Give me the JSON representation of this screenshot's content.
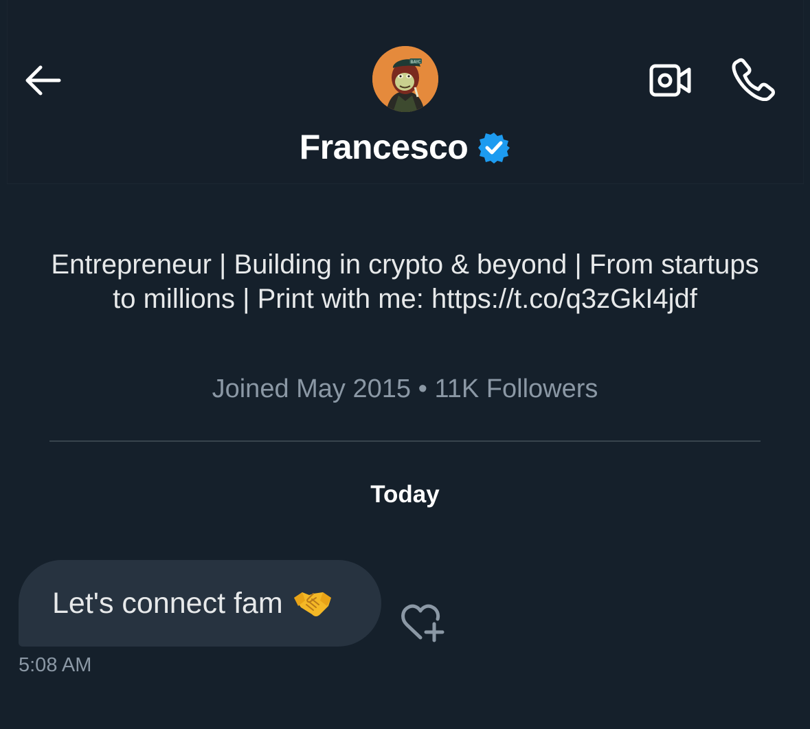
{
  "header": {
    "name": "Francesco",
    "verified": true,
    "back_icon": "arrow-left-icon",
    "video_icon": "video-call-icon",
    "phone_icon": "phone-icon",
    "avatar_icon": "ape-avatar",
    "verified_icon": "verified-badge-icon"
  },
  "profile": {
    "bio": "Entrepreneur | Building in crypto & beyond | From startups to millions | Print with me: https://t.co/q3zGkI4jdf",
    "meta": "Joined May 2015 • 11K Followers"
  },
  "conversation": {
    "day_label": "Today",
    "messages": [
      {
        "text": "Let's connect fam",
        "emoji_icon": "handshake-emoji",
        "time": "5:08 AM",
        "react_icon": "heart-plus-icon"
      }
    ]
  },
  "colors": {
    "background": "#15202b",
    "bubble": "#273340",
    "verified": "#1d9bf0",
    "secondary_text": "#8b98a5",
    "divider": "#38444d",
    "avatar_bg": "#e58a3c"
  }
}
